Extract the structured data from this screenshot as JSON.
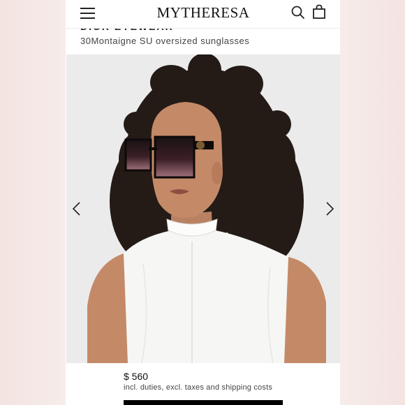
{
  "header": {
    "logo": "MYTHERESA",
    "icons": [
      "menu-icon",
      "search-icon",
      "shopping-bag-icon"
    ]
  },
  "product": {
    "brand": "DIOR EYEWEAR",
    "title": "30Montaigne SU oversized sunglasses",
    "price": "$ 560",
    "price_note": "incl. duties, excl. taxes and shipping costs"
  },
  "gallery": {
    "icons": [
      "chevron-left-icon",
      "chevron-right-icon"
    ]
  },
  "colors": {
    "side_background": "#f3e3e1",
    "image_background": "#ebebeb",
    "cta": "#000000"
  }
}
